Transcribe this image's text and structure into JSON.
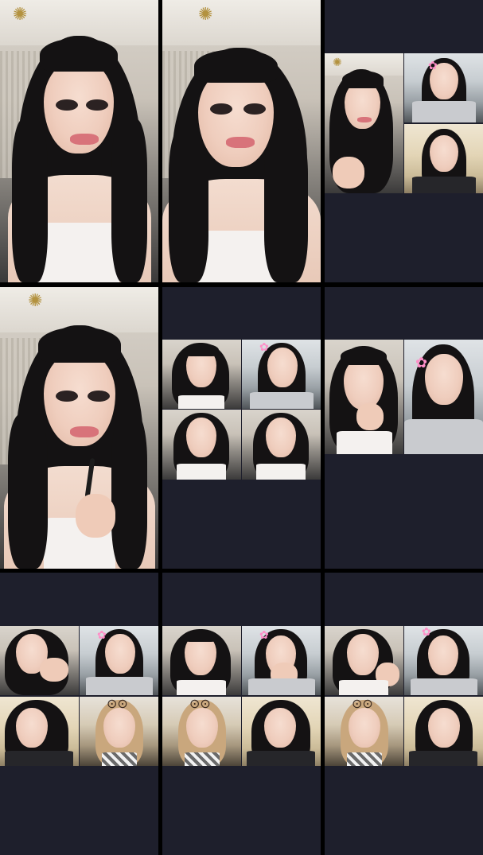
{
  "app": {
    "layout": "3x3 multi-stream live grid"
  },
  "colors": {
    "empty_panel": "#1e1f2c",
    "divider": "#000000",
    "hair": "#141213",
    "hair_blonde": "#c9a77d",
    "clip_pink": "#ff8fc8"
  },
  "cells": [
    {
      "id": "cell-1",
      "kind": "single",
      "tiles": 1
    },
    {
      "id": "cell-2",
      "kind": "single",
      "tiles": 1
    },
    {
      "id": "cell-3",
      "kind": "multi",
      "tiles": 3
    },
    {
      "id": "cell-4",
      "kind": "single",
      "tiles": 1
    },
    {
      "id": "cell-5",
      "kind": "multi",
      "tiles": 4
    },
    {
      "id": "cell-6",
      "kind": "multi",
      "tiles": 2
    },
    {
      "id": "cell-7",
      "kind": "multi",
      "tiles": 4
    },
    {
      "id": "cell-8",
      "kind": "multi",
      "tiles": 4
    },
    {
      "id": "cell-9",
      "kind": "multi",
      "tiles": 4
    }
  ],
  "icons": {
    "chandelier": "chandelier-icon",
    "hair_clip": "hair-clip-icon",
    "glasses": "glasses-icon"
  }
}
